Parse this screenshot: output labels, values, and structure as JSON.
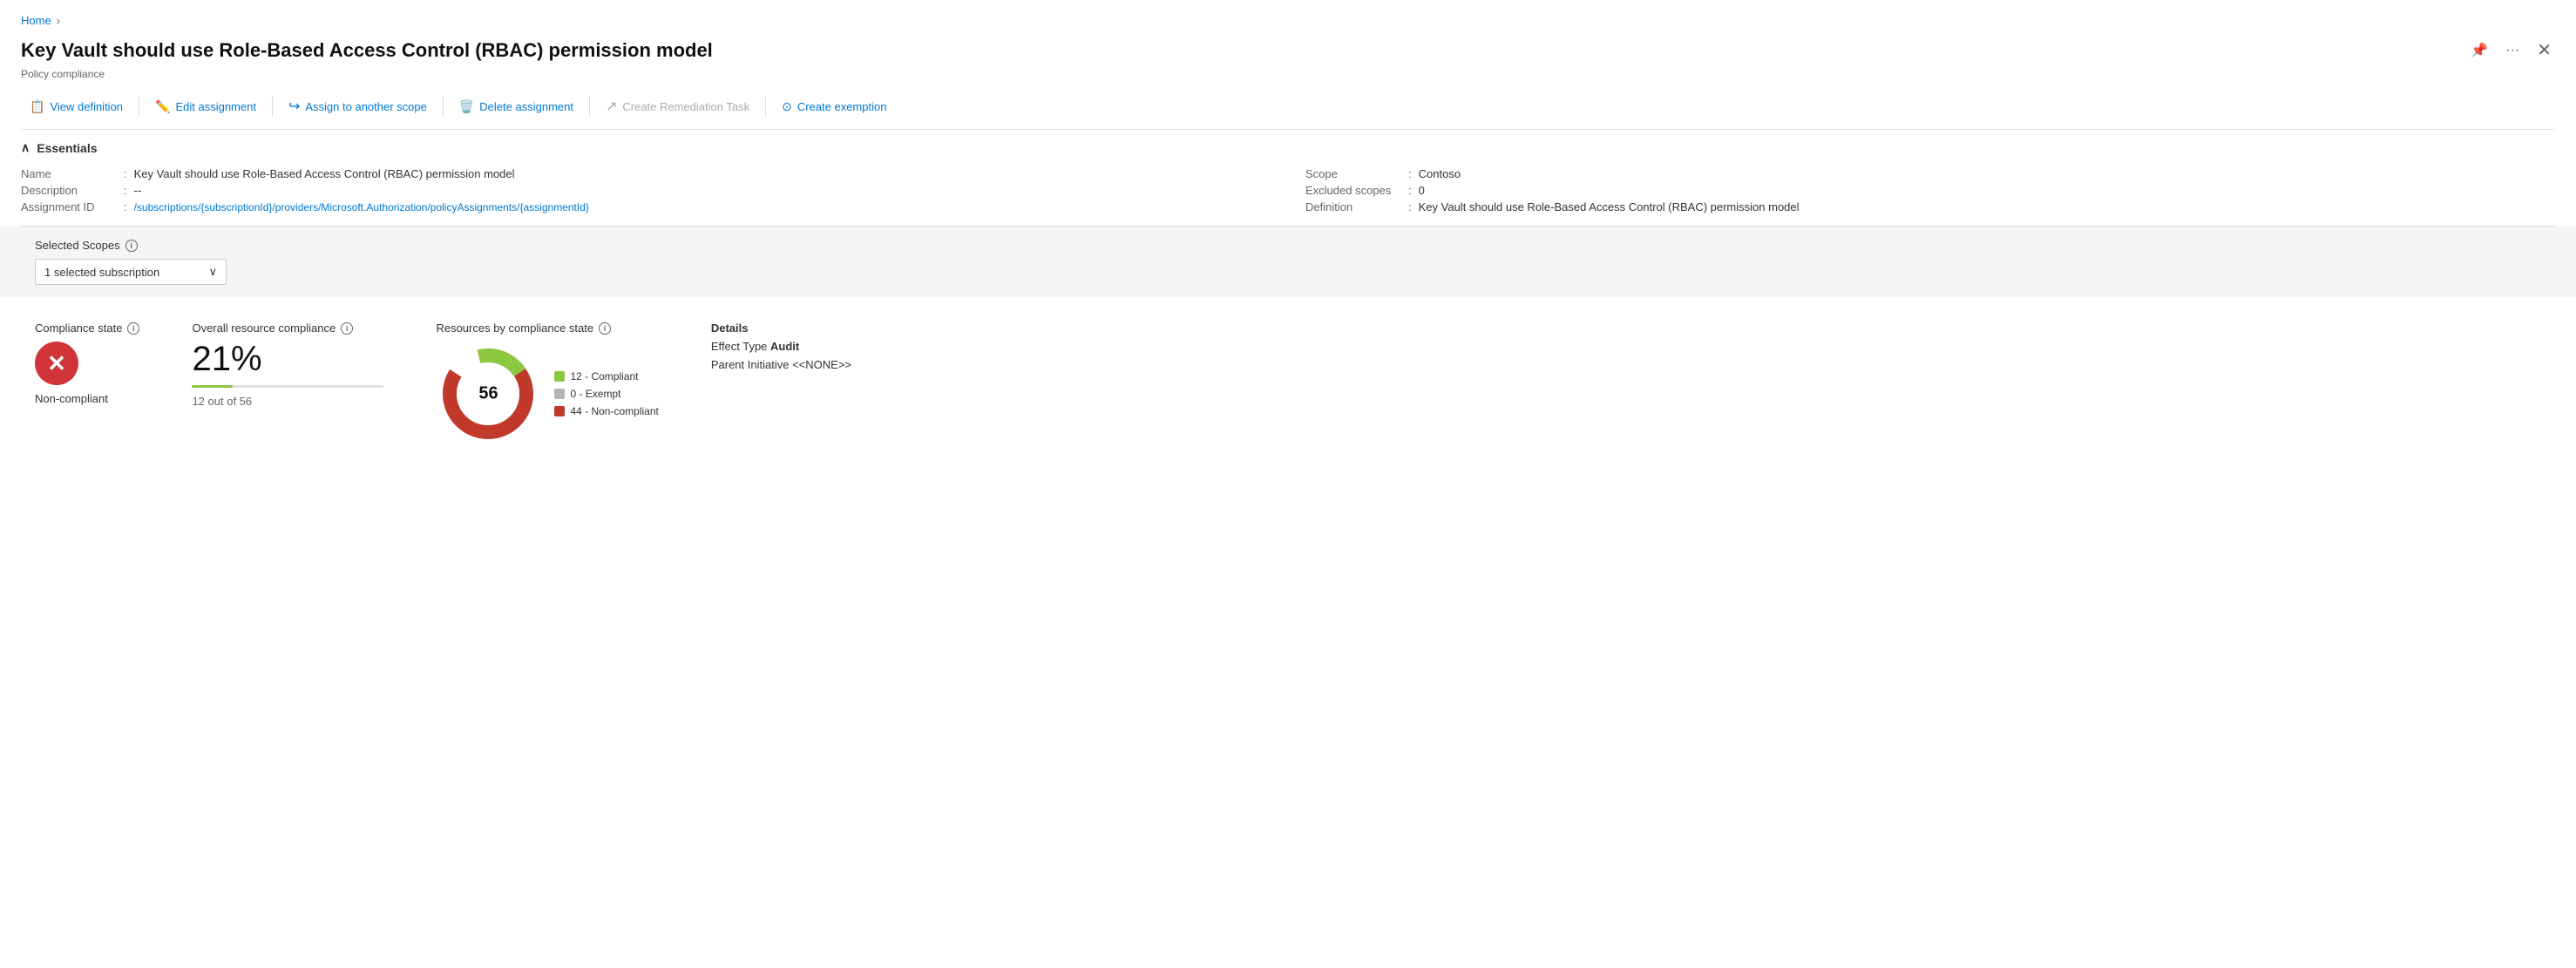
{
  "breadcrumb": {
    "home_label": "Home",
    "separator": "›"
  },
  "page": {
    "title": "Key Vault should use Role-Based Access Control (RBAC) permission model",
    "subtitle": "Policy compliance"
  },
  "toolbar": {
    "view_definition_label": "View definition",
    "edit_assignment_label": "Edit assignment",
    "assign_to_scope_label": "Assign to another scope",
    "delete_assignment_label": "Delete assignment",
    "create_remediation_label": "Create Remediation Task",
    "create_exemption_label": "Create exemption"
  },
  "essentials": {
    "header": "Essentials",
    "fields_left": [
      {
        "label": "Name",
        "value": "Key Vault should use Role-Based Access Control (RBAC) permission model"
      },
      {
        "label": "Description",
        "value": "--"
      },
      {
        "label": "Assignment ID",
        "value": "/subscriptions/{subscriptionId}/providers/Microsoft.Authorization/policyAssignments/{assignmentId}"
      }
    ],
    "fields_right": [
      {
        "label": "Scope",
        "value": "Contoso"
      },
      {
        "label": "Excluded scopes",
        "value": "0"
      },
      {
        "label": "Definition",
        "value": "Key Vault should use Role-Based Access Control (RBAC) permission model"
      }
    ]
  },
  "scopes": {
    "label": "Selected Scopes",
    "dropdown_value": "1 selected subscription"
  },
  "compliance_state": {
    "title": "Compliance state",
    "status": "Non-compliant",
    "icon_color": "#d13438"
  },
  "overall_compliance": {
    "title": "Overall resource compliance",
    "percent": "21%",
    "detail": "12 out of 56",
    "bar_fill_percent": 21
  },
  "resources_by_state": {
    "title": "Resources by compliance state",
    "total": "56",
    "compliant": {
      "count": 12,
      "label": "12 - Compliant",
      "color": "#8dc63f"
    },
    "exempt": {
      "count": 0,
      "label": "0 - Exempt",
      "color": "#b5b5b5"
    },
    "non_compliant": {
      "count": 44,
      "label": "44 - Non-compliant",
      "color": "#c0392b"
    }
  },
  "details": {
    "title": "Details",
    "effect_label": "Effect Type",
    "effect_value": "Audit",
    "initiative_label": "Parent Initiative",
    "initiative_value": "<<NONE>>"
  },
  "icons": {
    "view_definition": "📋",
    "edit": "✏️",
    "assign_scope": "📤",
    "delete": "🗑️",
    "remediation": "↗",
    "exemption": "🔵",
    "chevron_down": "∨",
    "pin": "📌",
    "more": "···",
    "close": "✕",
    "chevron_left": "∧"
  }
}
